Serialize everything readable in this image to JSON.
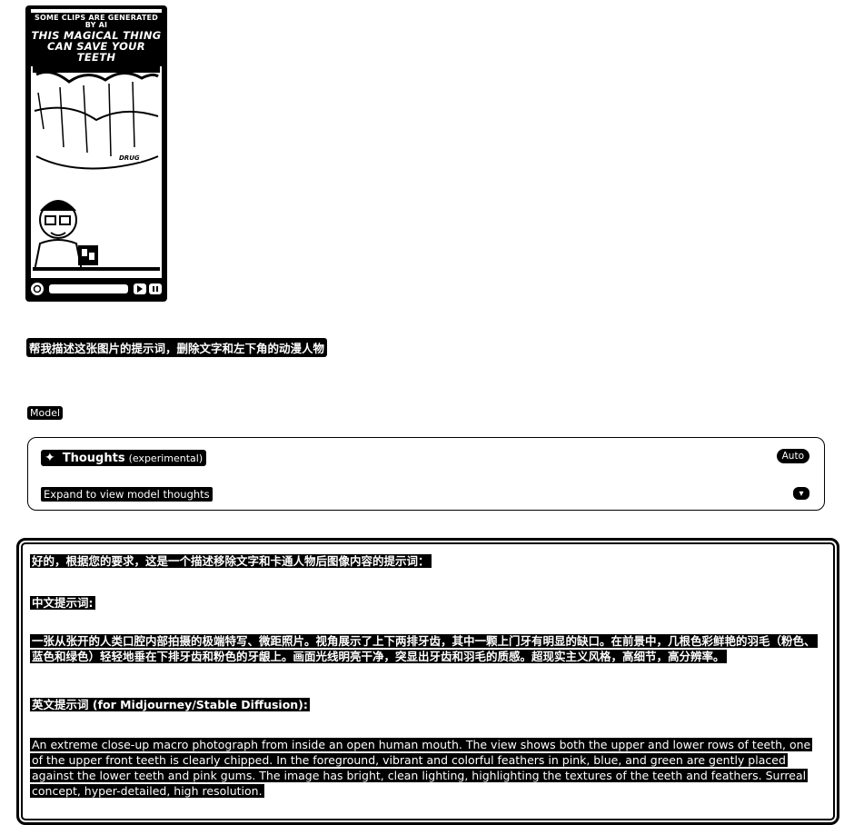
{
  "thumbnail": {
    "caption_top": "SOME CLIPS ARE GENERATED BY AI",
    "headline_1": "THIS MAGICAL THING",
    "headline_2": "CAN SAVE YOUR TEETH",
    "tag": "DRUG"
  },
  "conversation": {
    "user_message": "帮我描述这张图片的提示词，删除文字和左下角的动漫人物",
    "model_label": "Model",
    "thoughts": {
      "title": "Thoughts",
      "title_suffix": "(experimental)",
      "badge": "Auto",
      "expand_text": "Expand to view model thoughts"
    },
    "answer": {
      "intro": "好的，根据您的要求，这是一个描述移除文字和卡通人物后图像内容的提示词：",
      "cn_heading": "中文提示词:",
      "cn_body": "一张从张开的人类口腔内部拍摄的极端特写、微距照片。视角展示了上下两排牙齿，其中一颗上门牙有明显的缺口。在前景中，几根色彩鲜艳的羽毛（粉色、蓝色和绿色）轻轻地垂在下排牙齿和粉色的牙龈上。画面光线明亮干净，突显出牙齿和羽毛的质感。超现实主义风格，高细节，高分辨率。",
      "en_heading": "英文提示词 (for Midjourney/Stable Diffusion):",
      "en_body": "An extreme close-up macro photograph from inside an open human mouth. The view shows both the upper and lower rows of teeth, one of the upper front teeth is clearly chipped. In the foreground, vibrant and colorful feathers in pink, blue, and green are gently placed against the lower teeth and pink gums. The image has bright, clean lighting, highlighting the textures of the teeth and feathers. Surreal concept, hyper-detailed, high resolution."
    }
  },
  "icons": {
    "thumb_left": "gear-icon",
    "thumb_play": "play-icon",
    "thumb_more": "more-icon",
    "thoughts": "sparkle-icon",
    "expand": "chevron-down-icon"
  }
}
